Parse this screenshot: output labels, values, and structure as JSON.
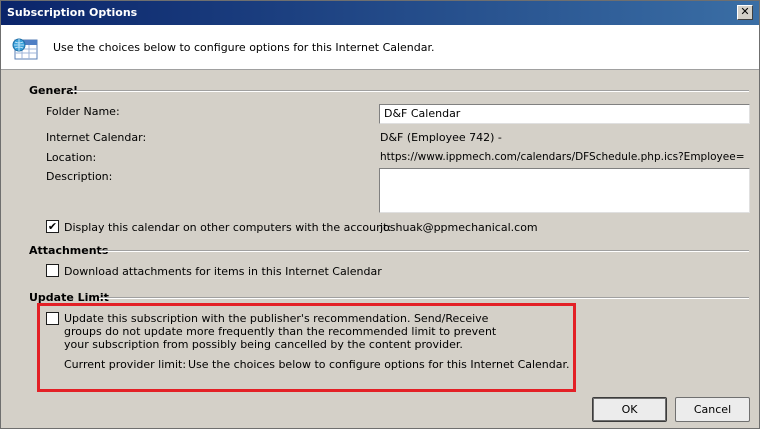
{
  "window": {
    "title": "Subscription Options",
    "close_glyph": "✕"
  },
  "header": {
    "icon": "calendar-globe-icon",
    "text": "Use the choices below to configure options for this Internet Calendar."
  },
  "general": {
    "title": "General",
    "folder_name_label": "Folder Name:",
    "folder_name_value": "D&F Calendar",
    "internet_calendar_label": "Internet Calendar:",
    "internet_calendar_value": "D&F (Employee 742) -",
    "location_label": "Location:",
    "location_value": "https://www.ippmech.com/calendars/DFSchedule.php.ics?Employee=",
    "description_label": "Description:",
    "description_value": "",
    "display_checkbox_label": "Display this calendar on other computers with the account:",
    "display_checkbox_checked": true,
    "account_value": "joshuak@ppmechanical.com"
  },
  "attachments": {
    "title": "Attachments",
    "download_label": "Download attachments for items in this Internet Calendar",
    "download_checked": false
  },
  "update_limit": {
    "title": "Update Limit",
    "line1": "Update this subscription with the publisher's recommendation. Send/Receive",
    "line2": "groups do not update more frequently than the recommended limit to prevent",
    "line3": "your subscription from possibly being cancelled by the content provider.",
    "checked": false,
    "provider_limit_label": "Current provider limit:",
    "provider_limit_value": "Use the choices below to configure options for this Internet Calendar.",
    "highlight_color": "#e32026"
  },
  "buttons": {
    "ok": "OK",
    "cancel": "Cancel"
  }
}
